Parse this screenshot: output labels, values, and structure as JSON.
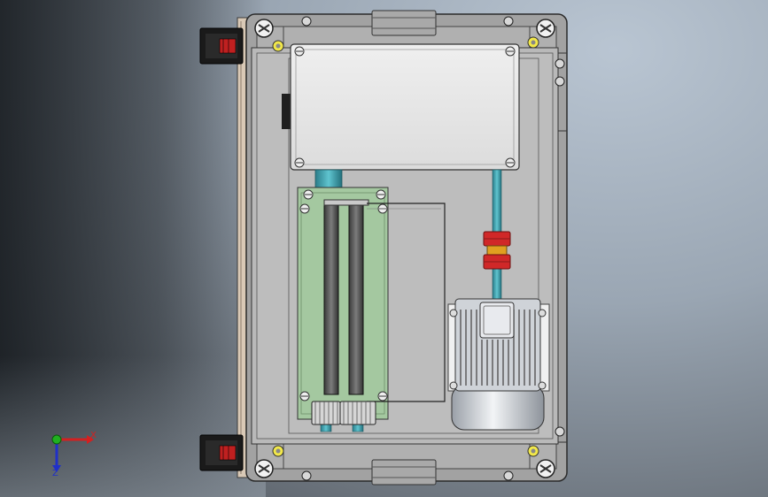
{
  "triad": {
    "x_label": "X",
    "z_label": "Z"
  },
  "colors": {
    "enclosure": "#9c9c9c",
    "panel": "#b9b9b9",
    "cover": "#e6e6e6",
    "shaft": "#3a9aa8",
    "coupling": "#d02828",
    "roller_frame": "#a4c8a0",
    "motor": "#d8dbe0",
    "axis_x": "#d42020",
    "axis_y": "#20b020",
    "axis_z": "#2030c8"
  },
  "icons": [
    "screw-head-icon",
    "hinge-icon",
    "triad-icon"
  ]
}
